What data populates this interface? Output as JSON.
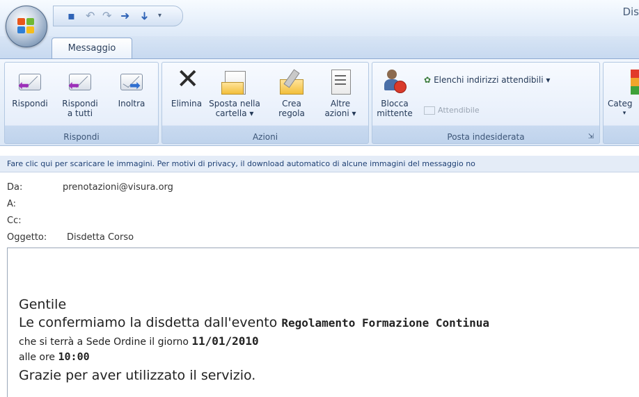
{
  "window": {
    "title": "Dis"
  },
  "ribbon_tabs": [
    "Messaggio"
  ],
  "groups": {
    "respond": {
      "label": "Rispondi",
      "buttons": [
        {
          "line1": "Rispondi",
          "line2": ""
        },
        {
          "line1": "Rispondi",
          "line2": "a tutti"
        },
        {
          "line1": "Inoltra",
          "line2": ""
        }
      ]
    },
    "actions": {
      "label": "Azioni",
      "buttons": [
        {
          "line1": "Elimina",
          "line2": ""
        },
        {
          "line1": "Sposta nella",
          "line2": "cartella ▾"
        },
        {
          "line1": "Crea",
          "line2": "regola"
        },
        {
          "line1": "Altre",
          "line2": "azioni ▾"
        }
      ]
    },
    "junk": {
      "label": "Posta indesiderata",
      "block": {
        "line1": "Blocca",
        "line2": "mittente"
      },
      "safe_lists": "Elenchi indirizzi attendibili ▾",
      "not_junk": "Attendibile"
    },
    "categorize": {
      "label": "Categ",
      "arrow": "▾"
    }
  },
  "infobar": "Fare clic qui per scaricare le immagini. Per motivi di privacy, il download automatico di alcune immagini del messaggio no",
  "headers": {
    "from": {
      "label": "Da:",
      "value": "prenotazioni@visura.org"
    },
    "to": {
      "label": "A:",
      "value": ""
    },
    "cc": {
      "label": "Cc:",
      "value": ""
    },
    "subject": {
      "label": "Oggetto:",
      "value": "Disdetta Corso"
    }
  },
  "body": {
    "greeting": "Gentile",
    "l1_prefix": "Le confermiamo la disdetta dall'evento ",
    "l1_event": "Regolamento Formazione Continua",
    "l2_prefix": "che si terrà a Sede Ordine il giorno ",
    "l2_date": "11/01/2010",
    "l3_prefix": "alle ore ",
    "l3_time": "10:00",
    "closing": "Grazie per aver utilizzato il servizio."
  },
  "colors": {
    "ribbon_bg": "#dbe7f6",
    "accent_blue": "#2f63b6",
    "reply_arrow": "#9c2fb8",
    "forward_arrow": "#2f6fd0"
  }
}
